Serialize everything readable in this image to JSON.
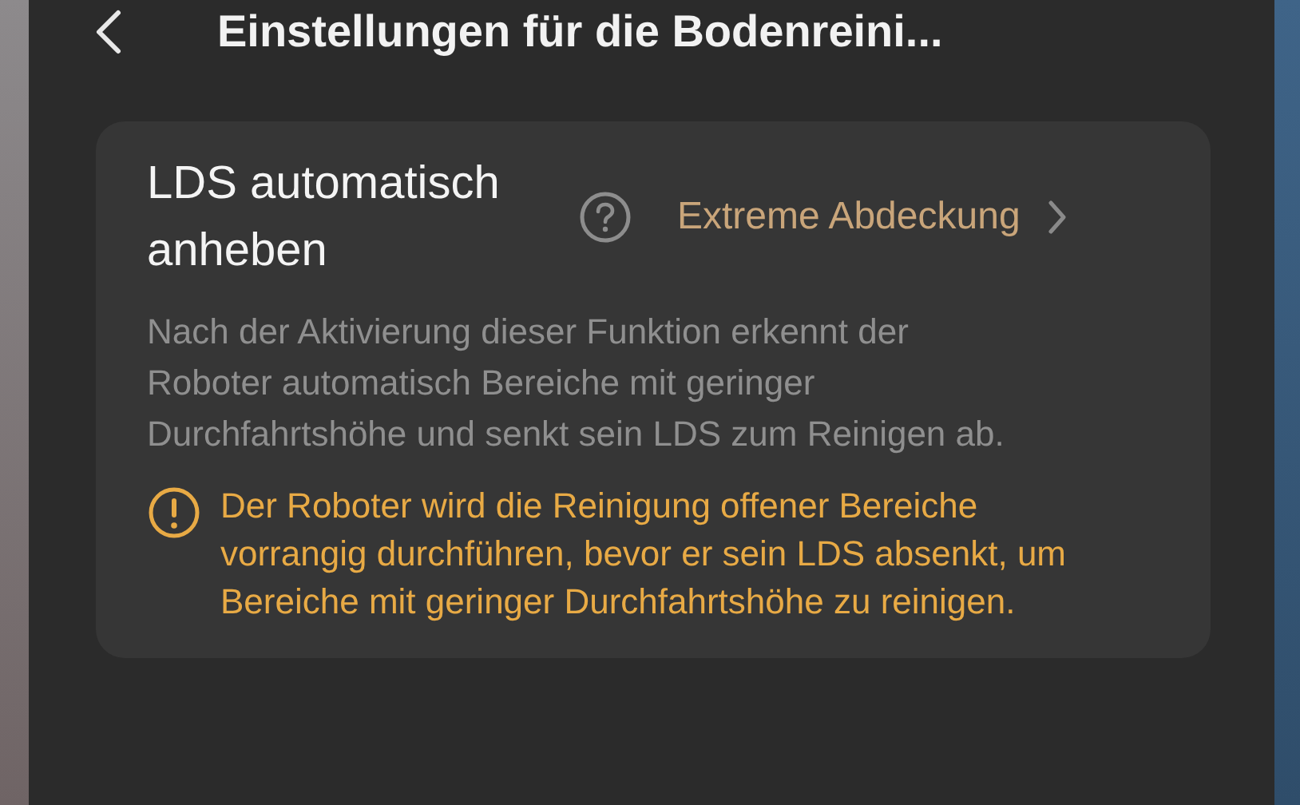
{
  "header": {
    "title": "Einstellungen für die Bodenreini..."
  },
  "setting": {
    "title": "LDS automatisch anheben",
    "value": "Extreme Abdeckung",
    "description": "Nach der Aktivierung dieser Funktion erkennt der Roboter automatisch Bereiche mit geringer Durchfahrtshöhe und senkt sein LDS zum Reinigen ab.",
    "warning": "Der Roboter wird die Reinigung offener Bereiche vorrangig durchführen, bevor er sein LDS absenkt, um Bereiche mit geringer Durchfahrtshöhe zu reinigen."
  }
}
